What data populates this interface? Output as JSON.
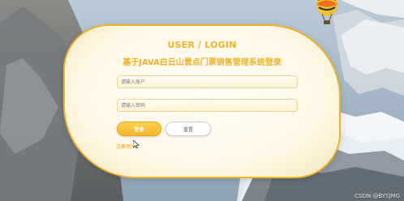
{
  "login": {
    "title_en": "USER / LOGIN",
    "title_cn": "基于JAVA白云山景点门票销售管理系统登录",
    "username_placeholder": "请输入账户",
    "password_placeholder": "请输入密码",
    "login_label": "登录",
    "reset_label": "重置",
    "register_label": "注册用户"
  },
  "watermark": "CSDN @BYSJMG",
  "icons": {
    "balloon": "hot-air-balloon-icon",
    "cursor": "mouse-pointer-icon"
  },
  "colors": {
    "accent": "#f0b42a",
    "card_background": "#fff8e7",
    "border": "#f2b223"
  }
}
